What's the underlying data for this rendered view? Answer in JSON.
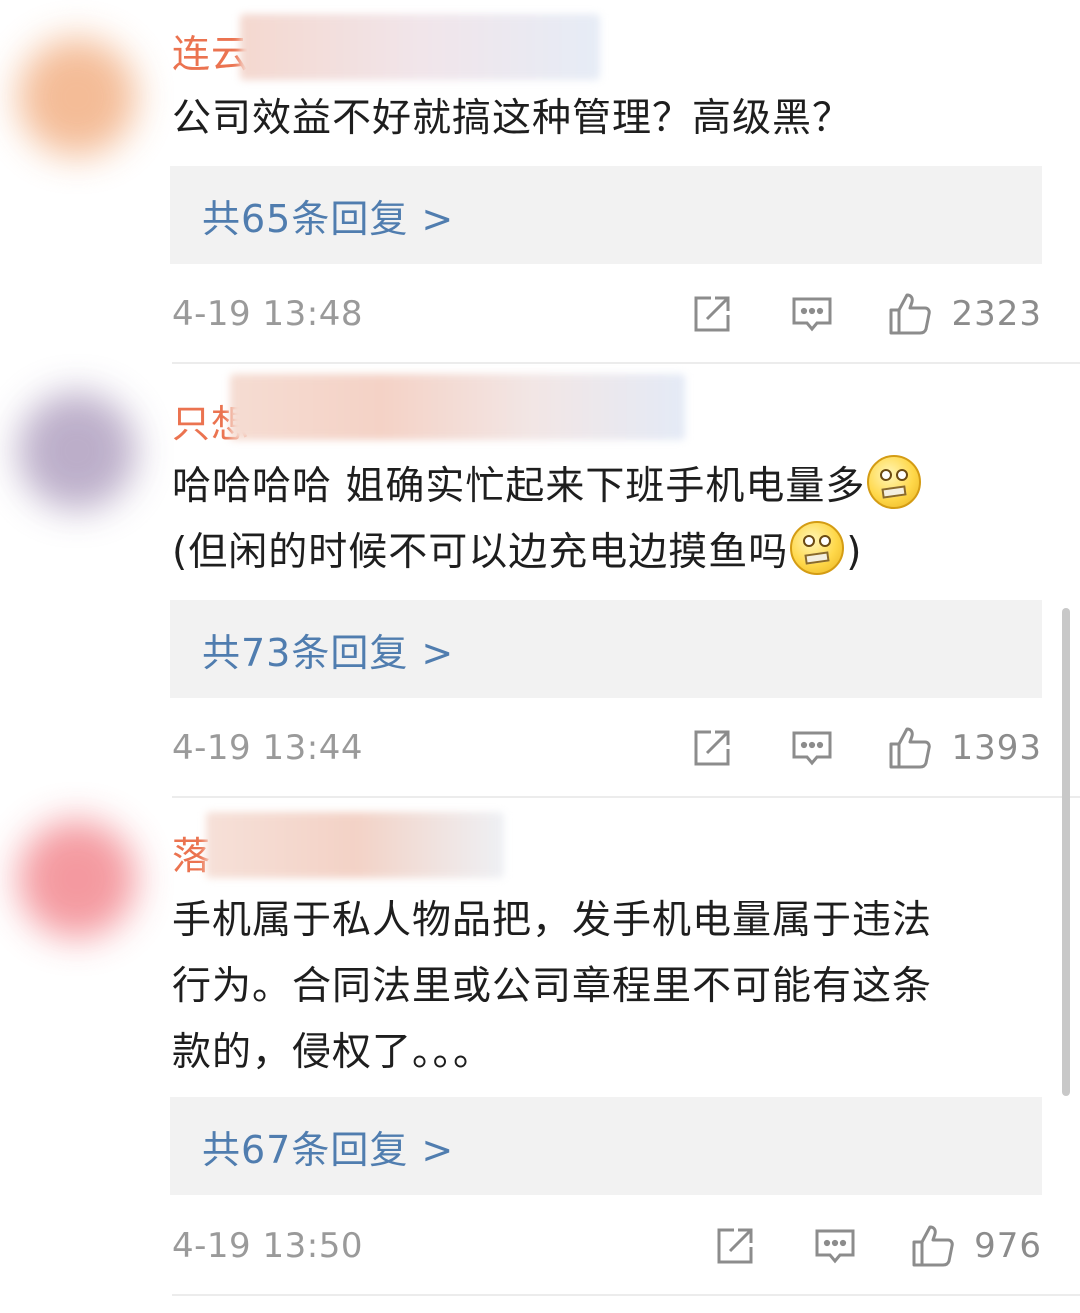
{
  "comments": [
    {
      "username": "连云",
      "text_lines": [
        "公司效益不好就搞这种管理？高级黑？"
      ],
      "replies_label": "共65条回复 >",
      "timestamp": "4-19 13:48",
      "like_count": "2323",
      "avatar_color": "#f3b58c",
      "name_blur_color": "#f1d5cc"
    },
    {
      "username": "只想",
      "text_line1": "哈哈哈哈 姐确实忙起来下班手机电量多",
      "text_line2_pre": "(但闲的时候不可以边充电边摸鱼吗",
      "text_line2_post": ")",
      "emoji_name": "silent-emoji",
      "replies_label": "共73条回复 >",
      "timestamp": "4-19 13:44",
      "like_count": "1393",
      "avatar_color": "#b5a6c4",
      "name_blur_color": "#f4d4c8"
    },
    {
      "username": "落",
      "text_lines": [
        "手机属于私人物品把，发手机电量属于违法",
        "行为。合同法里或公司章程里不可能有这条",
        "款的，侵权了。。。"
      ],
      "replies_label": "共67条回复 >",
      "timestamp": "4-19 13:50",
      "like_count": "976",
      "avatar_color": "#f38f96",
      "name_blur_color": "#f4d7cf"
    }
  ],
  "icons": {
    "share": "share-icon",
    "comment": "comment-icon",
    "like": "thumbs-up-icon"
  },
  "colors": {
    "username": "#eb7350",
    "replies_link": "#507daf",
    "meta_text": "#9a9a9a",
    "reply_box_bg": "#f2f2f2"
  }
}
